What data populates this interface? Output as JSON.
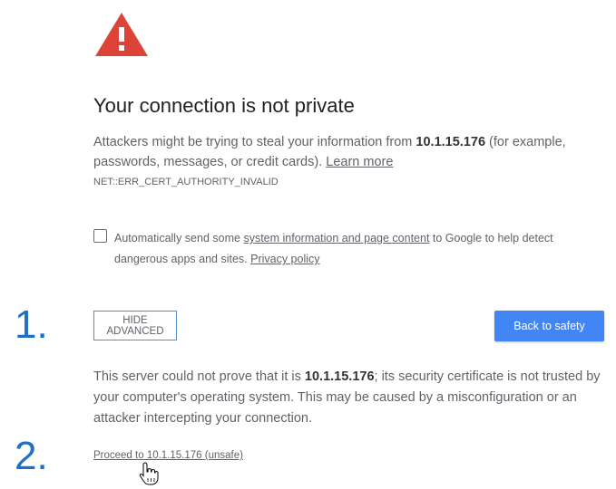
{
  "interstitial": {
    "title": "Your connection is not private",
    "desc_prefix": "Attackers might be trying to steal your information from ",
    "host": "10.1.15.176",
    "desc_suffix": " (for example, passwords, messages, or credit cards). ",
    "learn_more": "Learn more",
    "error_code": "NET::ERR_CERT_AUTHORITY_INVALID"
  },
  "optin": {
    "checked": false,
    "text_prefix": "Automatically send some ",
    "link_text": "system information and page content",
    "text_middle": " to Google to help detect dangerous apps and sites. ",
    "privacy_link": "Privacy policy"
  },
  "markers": {
    "one": "1.",
    "two": "2."
  },
  "buttons": {
    "hide_advanced": "HIDE ADVANCED",
    "back_to_safety": "Back to safety"
  },
  "details": {
    "prefix": "This server could not prove that it is ",
    "host": "10.1.15.176",
    "suffix": "; its security certificate is not trusted by your computer's operating system. This may be caused by a misconfiguration or an attacker intercepting your connection."
  },
  "proceed_link": "Proceed to 10.1.15.176 (unsafe)",
  "colors": {
    "warning_red": "#db4437",
    "primary_blue": "#4285f4",
    "marker_blue": "#1e6fc8"
  },
  "icons": {
    "warning": "warning-triangle-icon",
    "cursor": "hand-pointer-cursor-icon"
  }
}
